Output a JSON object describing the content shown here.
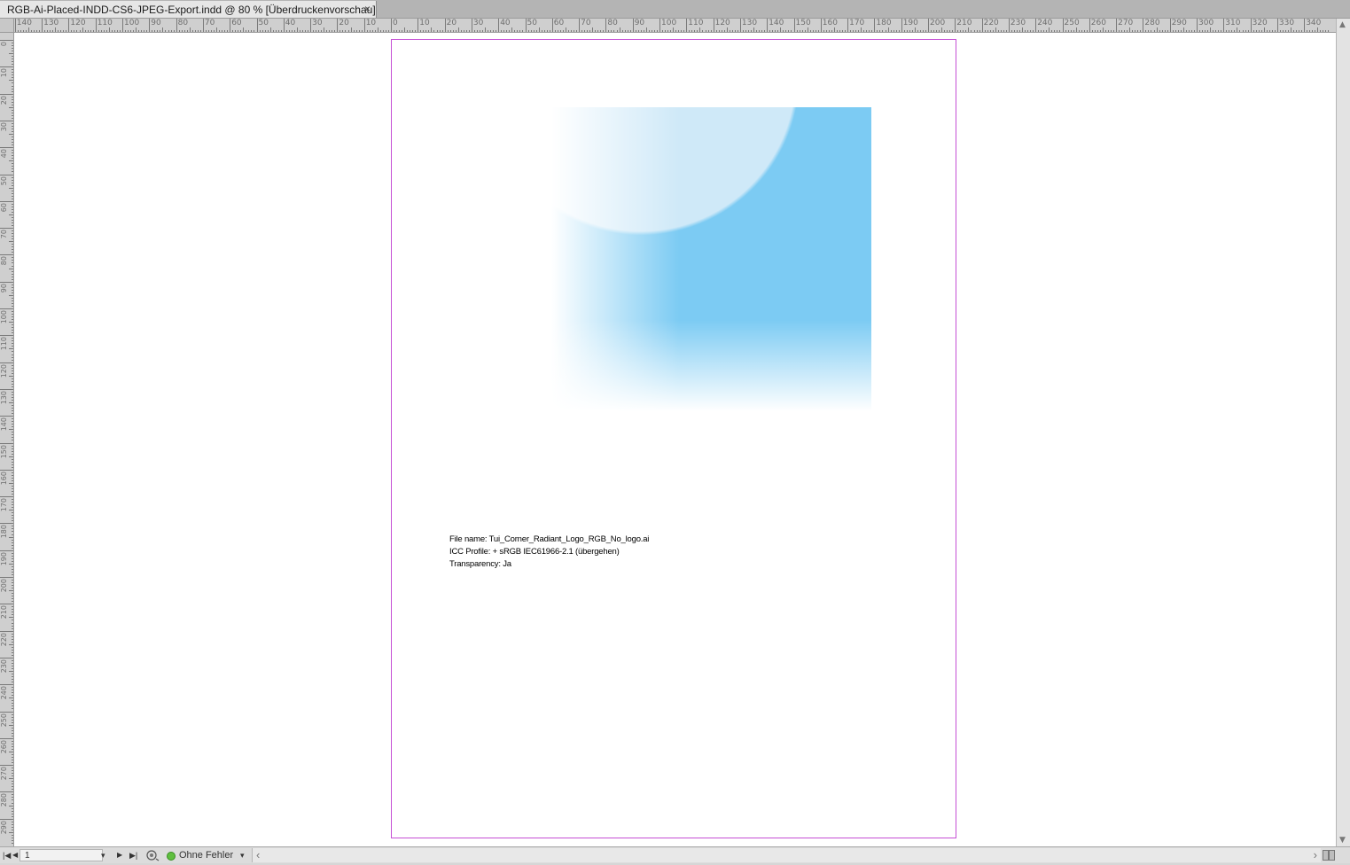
{
  "tab": {
    "title": "RGB-Ai-Placed-INDD-CS6-JPEG-Export.indd @ 80 % [Überdruckenvorschau]",
    "close": "×"
  },
  "ruler": {
    "h_labels": [
      "140",
      "130",
      "120",
      "110",
      "100",
      "90",
      "80",
      "70",
      "60",
      "50",
      "40",
      "30",
      "20",
      "10",
      "0",
      "10",
      "20",
      "30",
      "40",
      "50",
      "60",
      "70",
      "80",
      "90",
      "100",
      "110",
      "120",
      "130",
      "140",
      "150",
      "160",
      "170",
      "180",
      "190",
      "200",
      "210",
      "220",
      "230",
      "240",
      "250",
      "260",
      "270",
      "280",
      "290",
      "300",
      "310",
      "320",
      "330",
      "340"
    ],
    "v_labels": [
      "0",
      "10",
      "20",
      "30",
      "40",
      "50",
      "60",
      "70",
      "80",
      "90",
      "100",
      "110",
      "120",
      "130",
      "140",
      "150",
      "160",
      "170",
      "180",
      "190",
      "200",
      "210",
      "220",
      "230",
      "240",
      "250",
      "260",
      "270",
      "280",
      "290"
    ]
  },
  "document": {
    "info_lines": [
      "File name: Tui_Corner_Radiant_Logo_RGB_No_logo.ai",
      "ICC Profile: + sRGB IEC61966-2.1 (übergehen)",
      "Transparency: Ja"
    ],
    "colors": {
      "margin_guide": "#c54fd5",
      "graphic_blue": "#7ccbf3"
    }
  },
  "statusbar": {
    "page_number": "1",
    "preflight_status": "Ohne Fehler",
    "nav_first": "|◀",
    "nav_prev": "◀",
    "nav_next": "▶",
    "nav_last": "▶|",
    "dropdown": "▾",
    "scroll_left": "‹",
    "scroll_right": "›"
  },
  "scroll": {
    "up": "▲",
    "down": "▼"
  }
}
